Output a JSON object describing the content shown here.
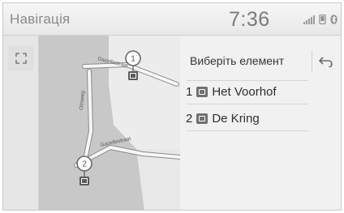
{
  "header": {
    "title": "Навігація",
    "time": "7:36"
  },
  "map": {
    "streets": [
      "Gazellestraat",
      "Olmweg",
      "Gazellestraat"
    ],
    "pins": [
      "1",
      "2"
    ]
  },
  "panel": {
    "select_label": "Виберіть елемент",
    "items": [
      {
        "number": "1",
        "name": "Het Voorhof"
      },
      {
        "number": "2",
        "name": "De Kring"
      }
    ]
  },
  "icons": {
    "expand": "expand-arrows-icon",
    "back": "back-arrow-icon",
    "signal": "signal-bars-icon",
    "phone": "phone-icon",
    "bluetooth": "bluetooth-icon"
  }
}
